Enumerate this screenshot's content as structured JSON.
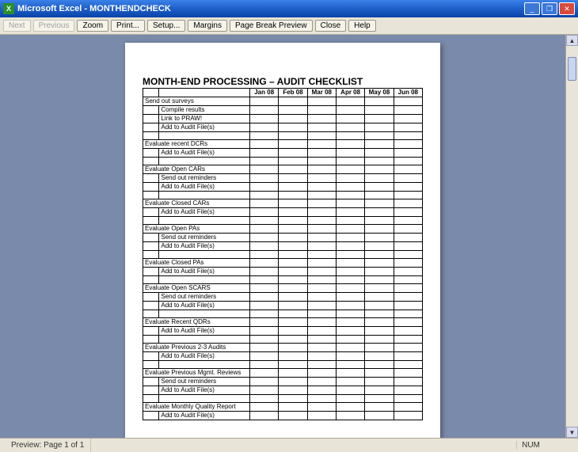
{
  "titlebar": {
    "app": "Microsoft Excel",
    "doc": "MONTHENDCHECK"
  },
  "toolbar": {
    "next": "Next",
    "previous": "Previous",
    "zoom": "Zoom",
    "print": "Print...",
    "setup": "Setup...",
    "margins": "Margins",
    "pagebreak": "Page Break Preview",
    "close": "Close",
    "help": "Help"
  },
  "sheet": {
    "title": "MONTH-END PROCESSING – AUDIT CHECKLIST",
    "months": [
      "Jan 08",
      "Feb 08",
      "Mar 08",
      "Apr 08",
      "May 08",
      "Jun 08"
    ],
    "rows": [
      {
        "a": "Send out surveys",
        "b": ""
      },
      {
        "a": "",
        "b": "Compile results"
      },
      {
        "a": "",
        "b": "Link to PRAW!"
      },
      {
        "a": "",
        "b": "Add to Audit File(s)"
      },
      {
        "a": "",
        "b": ""
      },
      {
        "a": "Evaluate recent DCRs",
        "b": ""
      },
      {
        "a": "",
        "b": "Add to Audit File(s)"
      },
      {
        "a": "",
        "b": ""
      },
      {
        "a": "Evaluate Open CARs",
        "b": ""
      },
      {
        "a": "",
        "b": "Send out reminders"
      },
      {
        "a": "",
        "b": "Add to Audit File(s)"
      },
      {
        "a": "",
        "b": ""
      },
      {
        "a": "Evaluate Closed CARs",
        "b": ""
      },
      {
        "a": "",
        "b": "Add to Audit File(s)"
      },
      {
        "a": "",
        "b": ""
      },
      {
        "a": "Evaluate Open PAs",
        "b": ""
      },
      {
        "a": "",
        "b": "Send out reminders"
      },
      {
        "a": "",
        "b": "Add to Audit File(s)"
      },
      {
        "a": "",
        "b": ""
      },
      {
        "a": "Evaluate Closed PAs",
        "b": ""
      },
      {
        "a": "",
        "b": "Add to Audit File(s)"
      },
      {
        "a": "",
        "b": ""
      },
      {
        "a": "Evaluate Open SCARS",
        "b": ""
      },
      {
        "a": "",
        "b": "Send out reminders"
      },
      {
        "a": "",
        "b": "Add to Audit File(s)"
      },
      {
        "a": "",
        "b": ""
      },
      {
        "a": "Evaluate Recent QDRs",
        "b": ""
      },
      {
        "a": "",
        "b": "Add to Audit File(s)"
      },
      {
        "a": "",
        "b": ""
      },
      {
        "a": "Evaluate Previous 2-3 Audits",
        "b": ""
      },
      {
        "a": "",
        "b": "Add to Audit File(s)"
      },
      {
        "a": "",
        "b": ""
      },
      {
        "a": "Evaluate Previous Mgmt. Reviews",
        "b": ""
      },
      {
        "a": "",
        "b": "Send out reminders"
      },
      {
        "a": "",
        "b": "Add to Audit File(s)"
      },
      {
        "a": "",
        "b": ""
      },
      {
        "a": "Evaluate Monthly Quality Report",
        "b": ""
      },
      {
        "a": "",
        "b": "Add to Audit File(s)"
      }
    ]
  },
  "status": {
    "preview": "Preview: Page 1 of 1",
    "num": "NUM"
  }
}
